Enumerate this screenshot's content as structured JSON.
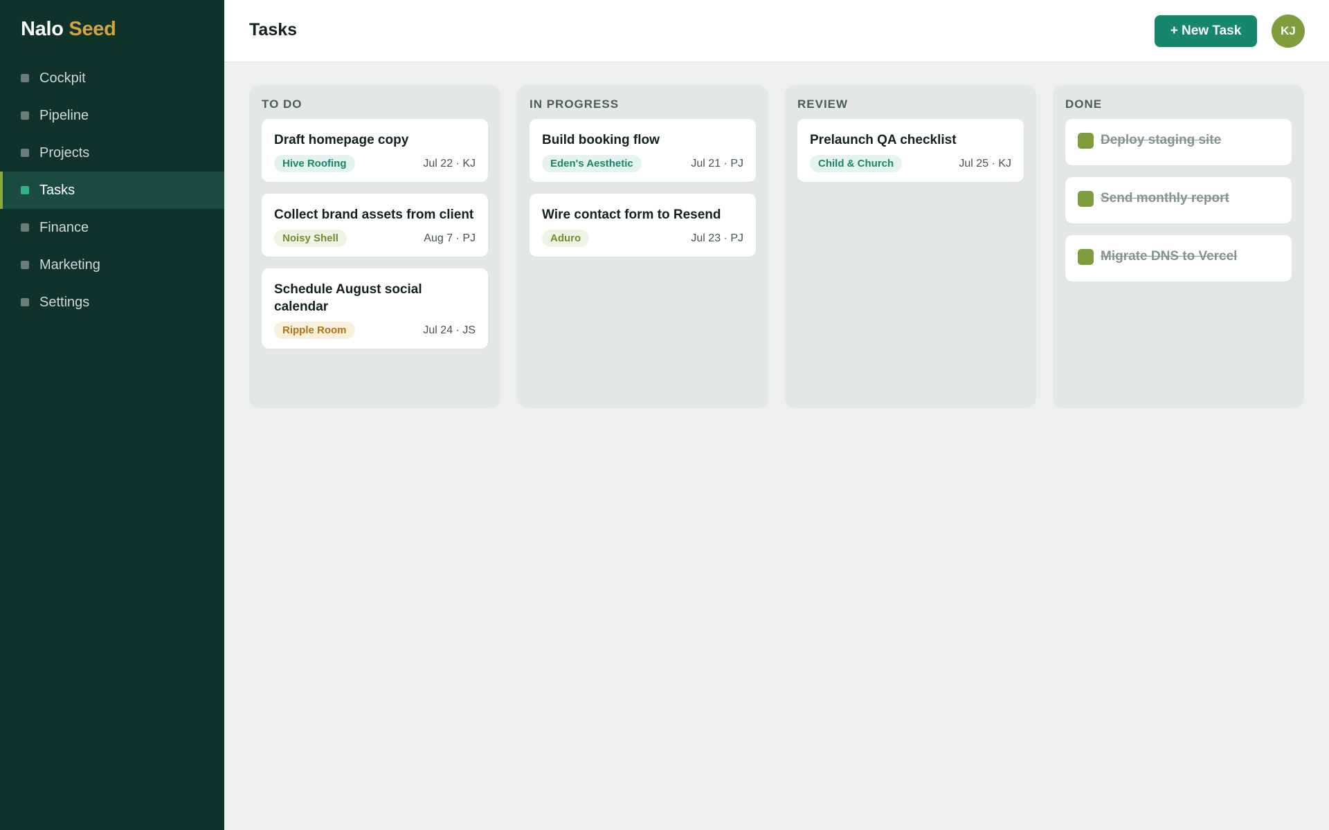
{
  "brand": {
    "part1": "Nalo",
    "part2": "Seed"
  },
  "sidebar": {
    "items": [
      {
        "label": "Cockpit",
        "active": false
      },
      {
        "label": "Pipeline",
        "active": false
      },
      {
        "label": "Projects",
        "active": false
      },
      {
        "label": "Tasks",
        "active": true
      },
      {
        "label": "Finance",
        "active": false
      },
      {
        "label": "Marketing",
        "active": false
      },
      {
        "label": "Settings",
        "active": false
      }
    ]
  },
  "header": {
    "title": "Tasks",
    "new_task_label": "+ New Task",
    "avatar_initials": "KJ"
  },
  "colors": {
    "sidebar_bg": "#0f322b",
    "accent": "#16876b",
    "brand_gold": "#d3a43f",
    "done_check": "#7e9d3d"
  },
  "columns": [
    {
      "title": "TO DO",
      "cards": [
        {
          "title": "Draft homepage copy",
          "tag": "Hive Roofing",
          "meta": "Jul 22 · KJ"
        },
        {
          "title": "Collect brand assets from client",
          "tag": "Noisy Shell",
          "meta": "Aug 7 · PJ"
        },
        {
          "title": "Schedule August social calendar",
          "tag": "Ripple Room",
          "meta": "Jul 24 · JS"
        }
      ]
    },
    {
      "title": "IN PROGRESS",
      "cards": [
        {
          "title": "Build booking flow",
          "tag": "Eden's Aesthetic",
          "meta": "Jul 21 · PJ"
        },
        {
          "title": "Wire contact form to Resend",
          "tag": "Aduro",
          "meta": "Jul 23 · PJ"
        }
      ]
    },
    {
      "title": "REVIEW",
      "cards": [
        {
          "title": "Prelaunch QA checklist",
          "tag": "Child & Church",
          "meta": "Jul 25 · KJ"
        }
      ]
    },
    {
      "title": "DONE",
      "cards": [
        {
          "title": "Deploy staging site",
          "done": true
        },
        {
          "title": "Send monthly report",
          "done": true
        },
        {
          "title": "Migrate DNS to Vercel",
          "done": true
        }
      ]
    }
  ]
}
